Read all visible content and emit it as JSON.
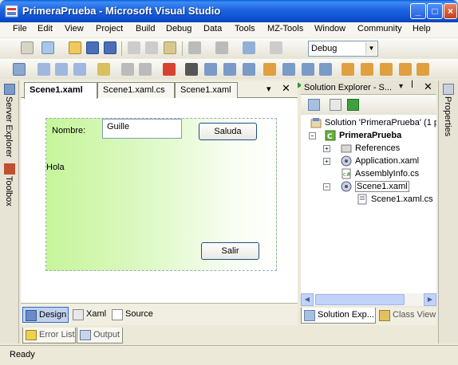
{
  "window": {
    "title": "PrimeraPrueba - Microsoft Visual Studio"
  },
  "menu": [
    "File",
    "Edit",
    "View",
    "Project",
    "Build",
    "Debug",
    "Data",
    "Tools",
    "MZ-Tools",
    "Window",
    "Community",
    "Help"
  ],
  "toolbar": {
    "config_value": "Debug"
  },
  "left_strip": {
    "server_explorer": "Server Explorer",
    "toolbox": "Toolbox"
  },
  "doc_tabs": [
    "Scene1.xaml",
    "Scene1.xaml.cs",
    "Scene1.xaml"
  ],
  "designer": {
    "nombre_label": "Nombre:",
    "name_value": "Guille",
    "saluda_button": "Saluda",
    "hola_label": "Hola",
    "salir_button": "Salir"
  },
  "view_buttons": {
    "design": "Design",
    "xaml": "Xaml",
    "source": "Source"
  },
  "bottom_tabs": {
    "error_list": "Error List",
    "output": "Output"
  },
  "solution_explorer": {
    "title": "Solution Explorer - S...",
    "solution": "Solution 'PrimeraPrueba' (1 p",
    "project": "PrimeraPrueba",
    "items": [
      "References",
      "Application.xaml",
      "AssemblyInfo.cs",
      "Scene1.xaml",
      "Scene1.xaml.cs"
    ],
    "tab_solution": "Solution Exp...",
    "tab_class": "Class View"
  },
  "right_strip": {
    "properties": "Properties"
  },
  "status": {
    "text": "Ready"
  },
  "icons": [
    "vs-app-icon",
    "minimize-icon",
    "maximize-icon",
    "close-icon",
    "start-debug-icon",
    "pin-icon",
    "solution-icon",
    "project-icon",
    "references-icon",
    "xaml-file-icon",
    "cs-file-icon"
  ]
}
